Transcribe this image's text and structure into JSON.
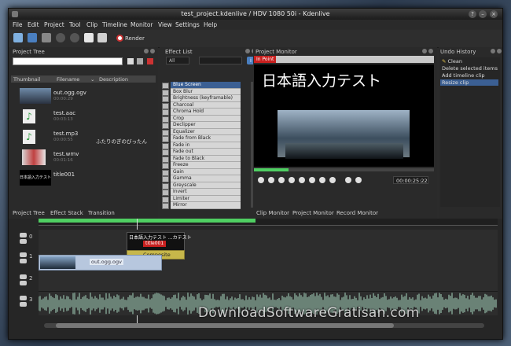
{
  "window": {
    "title": "test_project.kdenlive / HDV 1080 50i - Kdenlive"
  },
  "menu": [
    "File",
    "Edit",
    "Project",
    "Tool",
    "Clip",
    "Timeline",
    "Monitor",
    "View",
    "Settings",
    "Help"
  ],
  "toolbar": {
    "render_label": "Render"
  },
  "project_tree": {
    "title": "Project Tree",
    "columns": {
      "thumbnail": "Thumbnail",
      "filename": "Filename",
      "description": "Description"
    },
    "clips": [
      {
        "name": "out.ogg.ogv",
        "sub": "00:00:29",
        "description": ""
      },
      {
        "name": "test.aac",
        "sub": "00:03:13",
        "description": ""
      },
      {
        "name": "test.mp3",
        "sub": "00:00:55",
        "description": "ふたりのぎのびったん"
      },
      {
        "name": "test.wmv",
        "sub": "00:01:16",
        "description": ""
      },
      {
        "name": "title001",
        "sub": "",
        "description": ""
      }
    ],
    "title_thumb_text": "日本語入力テスト",
    "tabs": [
      "Project Tree",
      "Effect Stack",
      "Transition"
    ]
  },
  "effect_list": {
    "title": "Effect List",
    "filter": "All",
    "items": [
      "Blue Screen",
      "Box Blur",
      "Brightness (keyframable)",
      "Charcoal",
      "Chroma Hold",
      "Crop",
      "Declipper",
      "Equalizer",
      "Fade from Black",
      "Fade in",
      "Fade out",
      "Fade to Black",
      "Freeze",
      "Gain",
      "Gamma",
      "Greyscale",
      "Invert",
      "Limiter",
      "Mirror"
    ]
  },
  "monitor": {
    "title": "Project Monitor",
    "in_point": "In Point",
    "overlay_text": "日本語入力テスト",
    "timecode": "00:00:25:22",
    "tabs": [
      "Clip Monitor",
      "Project Monitor",
      "Record Monitor"
    ]
  },
  "undo_history": {
    "title": "Undo History",
    "items": [
      "Clean",
      "Delete selected items",
      "Add timeline clip",
      "Resize clip"
    ],
    "selected": 3
  },
  "timeline": {
    "tracks": [
      "0",
      "1",
      "2",
      "3"
    ],
    "title_clip_label": "日本語入力テスト ...カテスト",
    "title_clip_name": "title001",
    "composite_label": "Composite",
    "video_clip_label": "out.ogg.ogv"
  },
  "watermark": "DownloadSoftwareGratisan.com",
  "colors": {
    "accent": "#3b5f93",
    "timeline_green": "#4fcf62",
    "title_red": "#c8201f",
    "composite_yellow": "#c7b74a",
    "audio_green": "#a8d6c0"
  }
}
